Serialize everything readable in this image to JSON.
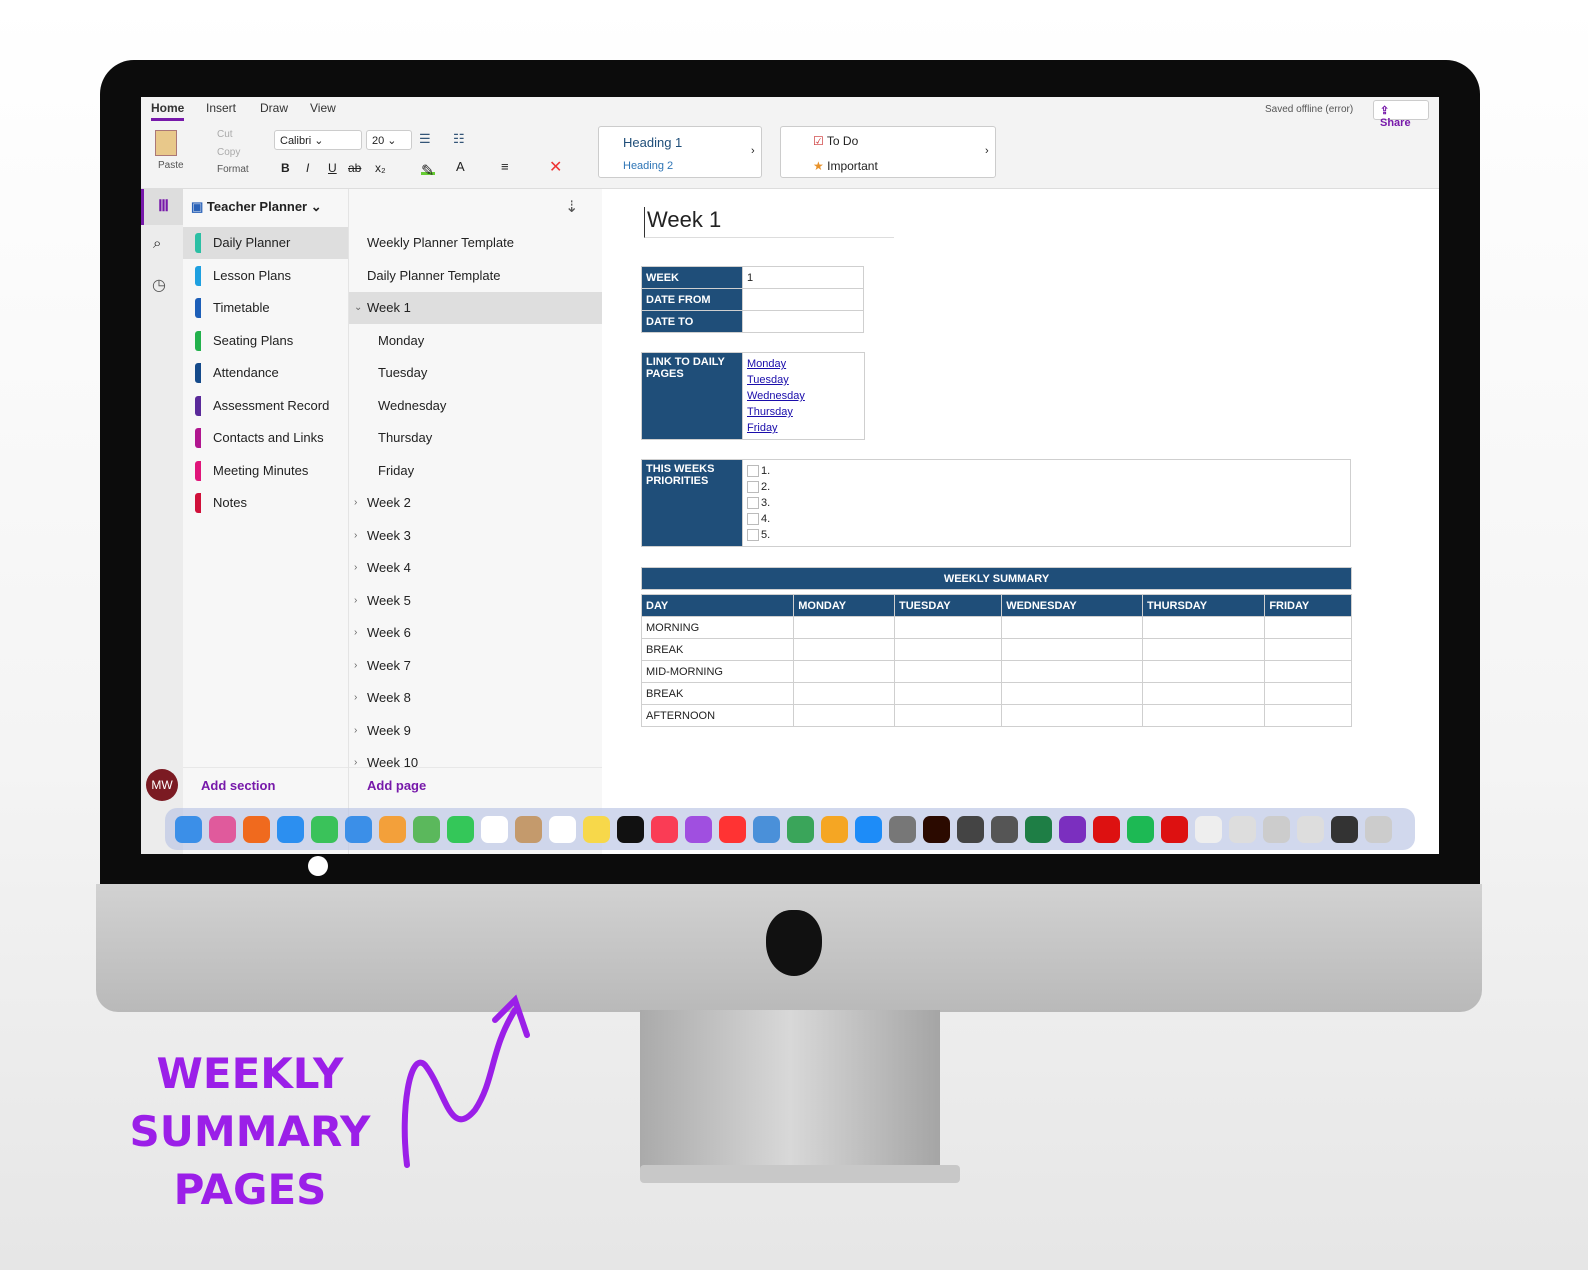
{
  "ribbon": {
    "tabs": [
      "Home",
      "Insert",
      "Draw",
      "View"
    ],
    "paste": "Paste",
    "cut": "Cut",
    "copy": "Copy",
    "format": "Format",
    "font": "Calibri",
    "size": "20",
    "bold": "B",
    "italic": "I",
    "underline": "U",
    "strike": "ab",
    "subscript": "x₂",
    "fontcolor": "A",
    "styles": [
      "Heading 1",
      "Heading 2"
    ],
    "tags": [
      "To Do",
      "Important"
    ],
    "status": "Saved offline (error)",
    "share": "Share"
  },
  "notebook": {
    "title": "Teacher Planner"
  },
  "sections": [
    {
      "label": "Daily Planner",
      "color": "#2bbfa4"
    },
    {
      "label": "Lesson Plans",
      "color": "#1ea0e0"
    },
    {
      "label": "Timetable",
      "color": "#1d5fb8"
    },
    {
      "label": "Seating Plans",
      "color": "#22b14c"
    },
    {
      "label": "Attendance",
      "color": "#154a8a"
    },
    {
      "label": "Assessment Record",
      "color": "#5a2a9a"
    },
    {
      "label": "Contacts and Links",
      "color": "#b0168f"
    },
    {
      "label": "Meeting Minutes",
      "color": "#e0157a"
    },
    {
      "label": "Notes",
      "color": "#d0103a"
    }
  ],
  "pages": [
    "Weekly Planner Template",
    "Daily Planner Template",
    "Week 1",
    "Monday",
    "Tuesday",
    "Wednesday",
    "Thursday",
    "Friday",
    "Week 2",
    "Week 3",
    "Week 4",
    "Week 5",
    "Week 6",
    "Week 7",
    "Week 8",
    "Week 9",
    "Week 10"
  ],
  "footer": {
    "avatar": "MW",
    "add_section": "Add section",
    "add_page": "Add page"
  },
  "page": {
    "title": "Week 1",
    "info": [
      {
        "label": "WEEK",
        "value": "1"
      },
      {
        "label": "DATE FROM",
        "value": ""
      },
      {
        "label": "DATE TO",
        "value": ""
      }
    ],
    "links_label": "LINK TO DAILY PAGES",
    "links": [
      "Monday",
      "Tuesday",
      "Wednesday",
      "Thursday",
      "Friday"
    ],
    "priorities_label": "THIS WEEKS PRIORITIES",
    "priorities": [
      "1.",
      "2.",
      "3.",
      "4.",
      "5."
    ],
    "summary": {
      "title": "WEEKLY SUMMARY",
      "columns": [
        "DAY",
        "MONDAY",
        "TUESDAY",
        "WEDNESDAY",
        "THURSDAY",
        "FRIDAY"
      ],
      "rows": [
        "MORNING",
        "BREAK",
        "MID-MORNING",
        "BREAK",
        "AFTERNOON"
      ]
    }
  },
  "dock": {
    "apps": [
      "finder",
      "launchpad",
      "brave",
      "safari",
      "messages",
      "mail",
      "photos",
      "maps",
      "facetime",
      "calendar",
      "contacts",
      "reminders",
      "notes",
      "apple-tv",
      "music",
      "podcasts",
      "news",
      "keynote",
      "numbers",
      "pages",
      "app-store",
      "system-preferences",
      "illustrator",
      "inkscape",
      "scrivener",
      "excel",
      "onenote",
      "acrobat",
      "spotify",
      "pdf",
      "document",
      "document",
      "finder-window",
      "window",
      "window",
      "trash"
    ],
    "calendar_day": "8"
  },
  "promo": {
    "lines": [
      "WEEKLY",
      "SUMMARY",
      "PAGES"
    ],
    "color": "#9b1fe8"
  }
}
